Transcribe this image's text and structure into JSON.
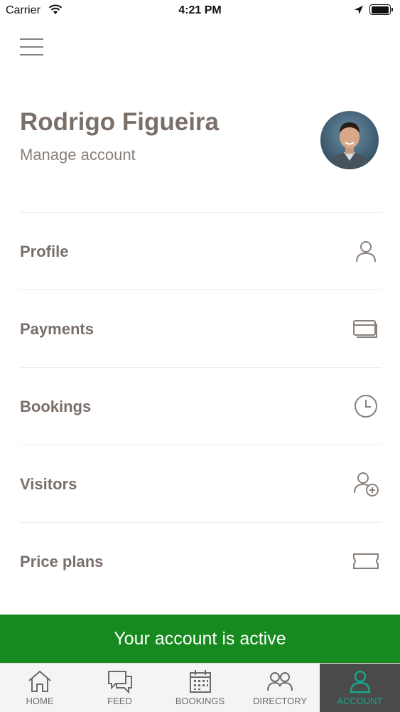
{
  "status": {
    "carrier": "Carrier",
    "time": "4:21 PM"
  },
  "header": {
    "menu_icon": "hamburger-menu-icon",
    "user_name": "Rodrigo Figueira",
    "manage_label": "Manage account"
  },
  "menu": [
    {
      "label": "Profile",
      "icon": "person-icon"
    },
    {
      "label": "Payments",
      "icon": "cards-icon"
    },
    {
      "label": "Bookings",
      "icon": "clock-icon"
    },
    {
      "label": "Visitors",
      "icon": "add-person-icon"
    },
    {
      "label": "Price plans",
      "icon": "ticket-icon"
    }
  ],
  "banner": {
    "text": "Your account is active",
    "color": "#168a1e"
  },
  "tabs": [
    {
      "label": "HOME",
      "icon": "home-icon"
    },
    {
      "label": "FEED",
      "icon": "chat-icon"
    },
    {
      "label": "BOOKINGS",
      "icon": "calendar-icon"
    },
    {
      "label": "DIRECTORY",
      "icon": "people-icon"
    },
    {
      "label": "ACCOUNT",
      "icon": "person-icon",
      "active": true
    }
  ],
  "colors": {
    "accent_active_tab": "#17a589",
    "text": "#7a6f69"
  }
}
